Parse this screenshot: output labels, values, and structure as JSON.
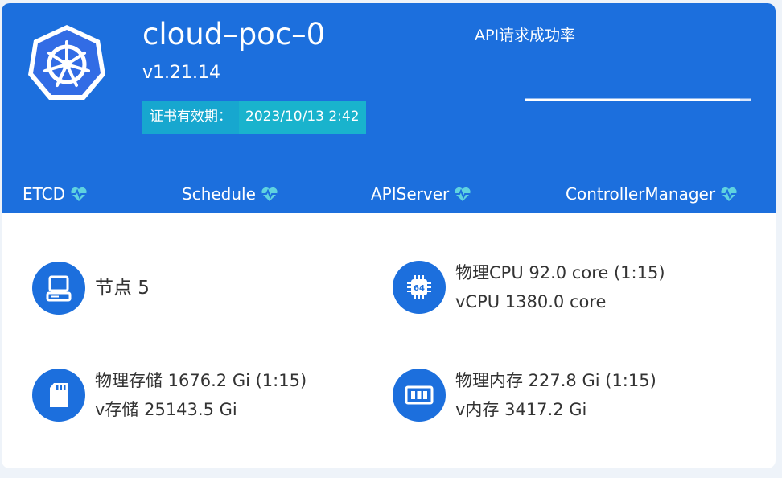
{
  "cluster": {
    "name": "cloud–poc–0",
    "version": "v1.21.14",
    "cert_label": "证书有效期：",
    "cert_value": "2023/10/13 2:42"
  },
  "api_chart": {
    "title": "API请求成功率"
  },
  "components": [
    {
      "label": "ETCD",
      "status_icon": "heart-pulse-icon"
    },
    {
      "label": "Schedule",
      "status_icon": "heart-pulse-icon"
    },
    {
      "label": "APIServer",
      "status_icon": "heart-pulse-icon"
    },
    {
      "label": "ControllerManager",
      "status_icon": "heart-pulse-icon"
    }
  ],
  "stats": {
    "nodes": {
      "icon": "computer-icon",
      "line1": "节点 5"
    },
    "cpu": {
      "icon": "cpu-chip-icon",
      "line1": "物理CPU 92.0 core (1:15)",
      "line2": "vCPU 1380.0 core"
    },
    "storage": {
      "icon": "sd-card-icon",
      "line1": "物理存储 1676.2 Gi (1:15)",
      "line2": "v存储 25143.5 Gi"
    },
    "memory": {
      "icon": "memory-stick-icon",
      "line1": "物理内存 227.8 Gi (1:15)",
      "line2": "v内存 3417.2 Gi"
    }
  },
  "colors": {
    "header_bg": "#1c6fdd",
    "cert_label_bg": "#17a7cf",
    "cert_value_bg": "#19b3cd",
    "heart": "#5fd3e0",
    "text": "#333333"
  }
}
